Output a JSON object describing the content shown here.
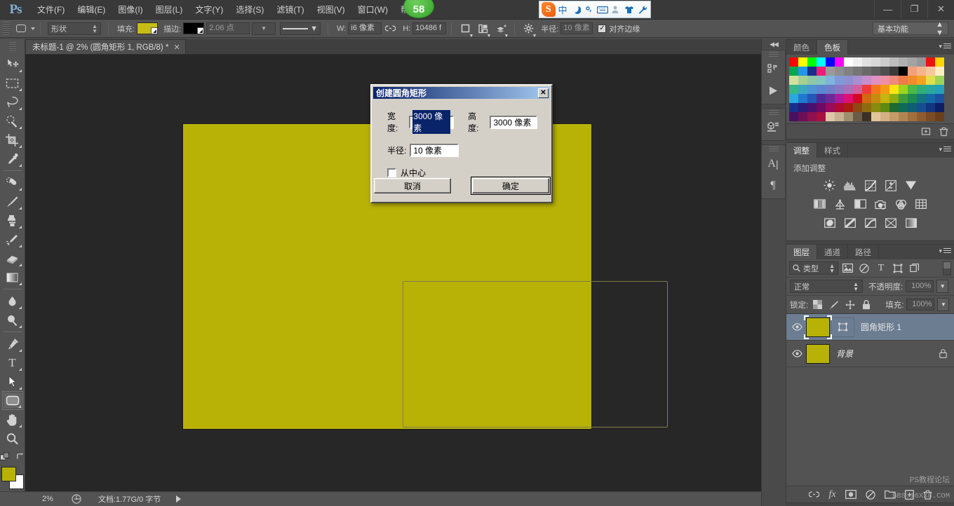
{
  "app": {
    "logo": "Ps",
    "menus": [
      {
        "label": "文件(F)"
      },
      {
        "label": "编辑(E)"
      },
      {
        "label": "图像(I)"
      },
      {
        "label": "图层(L)"
      },
      {
        "label": "文字(Y)"
      },
      {
        "label": "选择(S)"
      },
      {
        "label": "滤镜(T)"
      },
      {
        "label": "视图(V)"
      },
      {
        "label": "窗口(W)"
      },
      {
        "label": "帮助(H)"
      }
    ],
    "notification_badge": "58",
    "window_controls": {
      "minimize": "—",
      "restore": "❐",
      "close": "✕"
    },
    "ime": {
      "logo": "S",
      "items": [
        "中",
        "☽",
        "°,",
        "⌨",
        "👤",
        "👕",
        "🔧"
      ]
    }
  },
  "options_bar": {
    "tool_icon": "rounded-rectangle-tool",
    "shape_mode": "形状",
    "fill_label": "填充:",
    "fill_color": "#c6bc16",
    "stroke_label": "描边:",
    "stroke_color": "#000000",
    "stroke_weight": "2.06 点",
    "stroke_style": "solid-line",
    "w_label": "W:",
    "w_value": "i6 像素",
    "link_icon": "link-icon",
    "h_label": "H:",
    "h_value": "10486 f",
    "path_ops_icon": "path-operations-icon",
    "path_align_icon": "path-alignment-icon",
    "path_arrange_icon": "path-arrangement-icon",
    "gear_icon": "gear-icon",
    "radius_label": "半径:",
    "radius_value": "10 像素",
    "align_edges_checked": "✓",
    "align_edges_label": "对齐边缘",
    "workspace": "基本功能"
  },
  "toolbar": {
    "tools": [
      {
        "name": "move-tool",
        "active": false
      },
      {
        "name": "rectangular-marquee-tool",
        "active": false
      },
      {
        "name": "lasso-tool",
        "active": false
      },
      {
        "name": "quick-selection-tool",
        "active": false
      },
      {
        "name": "crop-tool",
        "active": false
      },
      {
        "name": "eyedropper-tool",
        "active": false
      },
      {
        "name": "spot-healing-brush-tool",
        "active": false
      },
      {
        "name": "brush-tool",
        "active": false
      },
      {
        "name": "clone-stamp-tool",
        "active": false
      },
      {
        "name": "history-brush-tool",
        "active": false
      },
      {
        "name": "eraser-tool",
        "active": false
      },
      {
        "name": "gradient-tool",
        "active": false
      },
      {
        "name": "blur-tool",
        "active": false
      },
      {
        "name": "dodge-tool",
        "active": false
      },
      {
        "name": "pen-tool",
        "active": false
      },
      {
        "name": "horizontal-type-tool",
        "active": false
      },
      {
        "name": "path-selection-tool",
        "active": false
      },
      {
        "name": "rounded-rectangle-tool",
        "active": true
      },
      {
        "name": "hand-tool",
        "active": false
      },
      {
        "name": "zoom-tool",
        "active": false
      }
    ],
    "foreground_color": "#b8b207",
    "background_color": "#ffffff",
    "quick_mask": "quick-mask-icon"
  },
  "document": {
    "tab_title": "未标题-1 @ 2% (圆角矩形 1, RGB/8) *",
    "close_glyph": "✕",
    "canvas_bg": "#272727",
    "artboard_color": "#b8b207",
    "shape_outline_color": "#7e7c4b"
  },
  "status_bar": {
    "zoom": "2%",
    "preview_icon": "document-preview-icon",
    "doc_info": "文档:1.77G/0 字节",
    "expand_icon": "expand-arrow-icon"
  },
  "dock_strip": {
    "collapse_icon": "◀◀",
    "groups": [
      {
        "icons": [
          "history-icon",
          "actions-play-icon"
        ]
      },
      {
        "icons": [
          "3d-icon"
        ]
      },
      {
        "icons": [
          "character-icon",
          "paragraph-icon"
        ]
      }
    ]
  },
  "panels": {
    "swatches": {
      "tabs": [
        {
          "label": "颜色",
          "active": false
        },
        {
          "label": "色板",
          "active": true
        }
      ],
      "rows": [
        [
          "#ff0000",
          "#ffff00",
          "#00ff00",
          "#00ffff",
          "#0000ff",
          "#ff00ff",
          "#ffffff",
          "#f0f0f0",
          "#e0e0e0",
          "#d8d8d8",
          "#cccccc",
          "#bdbdbd",
          "#b0b0b0",
          "#a3a3a3",
          "#969696",
          "#ee1111",
          "#ffd500"
        ],
        [
          "#00a651",
          "#2196e8",
          "#1b2c8a",
          "#e81f7a",
          "#9a9a9a",
          "#8e8e8e",
          "#828282",
          "#767676",
          "#6a6a6a",
          "#5e5e5e",
          "#4f4f4f",
          "#3a3a3a",
          "#000000",
          "#f4a07a",
          "#f7b48c",
          "#f9c79f",
          "#fdeec2"
        ],
        [
          "#cfe0a0",
          "#a7cf90",
          "#8fc8a4",
          "#84c6c0",
          "#7fb4e0",
          "#8298d8",
          "#8f8fd4",
          "#a98fd0",
          "#c78fcb",
          "#e08fc0",
          "#ef8fa6",
          "#f08a7a",
          "#ef7a4a",
          "#f08c2e",
          "#f2a320",
          "#dfe04a",
          "#9cd45a"
        ],
        [
          "#36b88a",
          "#3aa8c0",
          "#4a95d2",
          "#5a86cf",
          "#6f7ec9",
          "#8a78c4",
          "#a96fb8",
          "#d35fa0",
          "#ef3b3b",
          "#f3761e",
          "#f59a16",
          "#fbe511",
          "#9dd51e",
          "#4bb84a",
          "#2fae7a",
          "#2aa8a0",
          "#24a1b8"
        ],
        [
          "#28a9e0",
          "#2079cf",
          "#2358b8",
          "#4d2b96",
          "#6a2b96",
          "#b0189b",
          "#e00f70",
          "#cf0c1f",
          "#cf6a10",
          "#c98a12",
          "#c6b40f",
          "#8fae10",
          "#3f9c3a",
          "#1d8a52",
          "#13757d",
          "#1568a8",
          "#1a52a0"
        ],
        [
          "#1a2f8c",
          "#2b1a78",
          "#4a1070",
          "#6d0a66",
          "#9b0a5c",
          "#b00a32",
          "#a81d10",
          "#8a4a10",
          "#8f6b10",
          "#8a8a0c",
          "#5f8a10",
          "#1d6b2e",
          "#0f6b56",
          "#0d5f72",
          "#154f8f",
          "#13357f",
          "#0c1f66"
        ],
        [
          "#4a1060",
          "#6b0f56",
          "#8f1050",
          "#a81040",
          "#ddc8a8",
          "#c9b090",
          "#a08e70",
          "#6b5c46",
          "#3a3026",
          "#e0c69a",
          "#d4b184",
          "#c39c6a",
          "#b18552",
          "#a06f3e",
          "#8e5c30",
          "#7a4b24",
          "#6b3e1c"
        ]
      ],
      "footer_icons": [
        "new-swatch-icon",
        "delete-swatch-icon"
      ]
    },
    "adjustments": {
      "tabs": [
        {
          "label": "调整",
          "active": true
        },
        {
          "label": "样式",
          "active": false
        }
      ],
      "title": "添加调整",
      "icon_rows": [
        [
          "brightness-contrast-icon",
          "levels-icon",
          "curves-icon",
          "exposure-icon",
          "vibrance-icon"
        ],
        [
          "hue-saturation-icon",
          "color-balance-icon",
          "black-white-icon",
          "photo-filter-icon",
          "channel-mixer-icon",
          "color-lookup-icon"
        ],
        [
          "invert-icon",
          "posterize-icon",
          "threshold-icon",
          "gradient-map-icon",
          "selective-color-icon"
        ]
      ]
    },
    "layers": {
      "tabs": [
        {
          "label": "图层",
          "active": true
        },
        {
          "label": "通道",
          "active": false
        },
        {
          "label": "路径",
          "active": false
        }
      ],
      "filter": {
        "search_icon": "search-icon",
        "kind": "类型",
        "icons": [
          "filter-pixel-icon",
          "filter-adjustment-icon",
          "filter-type-icon",
          "filter-shape-icon",
          "filter-smart-icon"
        ],
        "toggle": "filter-toggle"
      },
      "blend_mode": "正常",
      "opacity_label": "不透明度:",
      "opacity_value": "100%",
      "lock_label": "锁定:",
      "lock_icons": [
        "lock-transparency-icon",
        "lock-image-icon",
        "lock-position-icon",
        "lock-all-icon"
      ],
      "fill_label": "填充:",
      "fill_value": "100%",
      "rows": [
        {
          "name": "圆角矩形 1",
          "selected": true,
          "visible": true,
          "locked": false,
          "thumb_color": "#b8b207",
          "has_vector_mask": true
        },
        {
          "name": "背景",
          "selected": false,
          "visible": true,
          "locked": true,
          "thumb_color": "#b8b207",
          "has_vector_mask": false
        }
      ],
      "footer_icons": [
        "link-layers-icon",
        "layer-style-fx-icon",
        "layer-mask-icon",
        "new-adjustment-icon",
        "new-group-icon",
        "new-layer-icon",
        "delete-layer-icon"
      ]
    },
    "watermark": {
      "line1": "PS教程论坛",
      "line2": "BBS.16XX8.COM"
    }
  },
  "dialog": {
    "title": "创建圆角矩形",
    "close_glyph": "✕",
    "width_label": "宽度:",
    "width_value": "3000 像素",
    "height_label": "高度:",
    "height_value": "3000 像素",
    "radius_label": "半径:",
    "radius_value": "10 像素",
    "from_center_label": "从中心",
    "from_center_checked": false,
    "cancel_label": "取消",
    "ok_label": "确定"
  }
}
